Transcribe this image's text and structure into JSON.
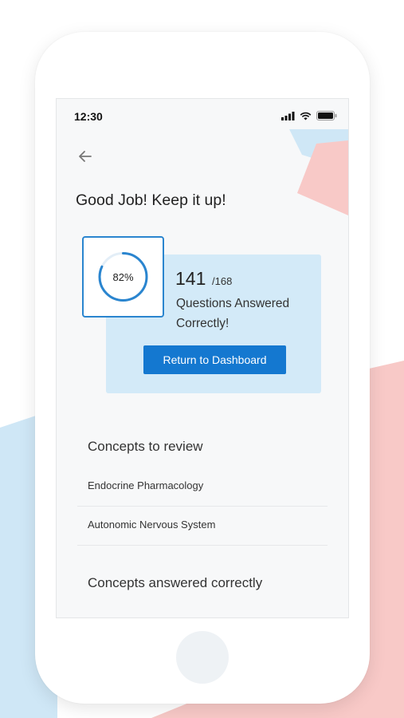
{
  "status_bar": {
    "time": "12:30"
  },
  "header": {
    "title": "Good Job! Keep it up!"
  },
  "result": {
    "percent_label": "82%",
    "percent_value": 82,
    "correct": "141",
    "total": "/168",
    "caption": "Questions Answered Correctly!",
    "button_label": "Return to Dashboard"
  },
  "review": {
    "heading": "Concepts to review",
    "items": [
      "Endocrine Pharmacology",
      "Autonomic Nervous System"
    ]
  },
  "correct_section": {
    "heading": "Concepts answered correctly"
  },
  "colors": {
    "accent": "#1478d0",
    "card_bg": "#d3eaf8",
    "bg_pink": "#f8c9c7",
    "bg_blue": "#cfe7f6"
  }
}
